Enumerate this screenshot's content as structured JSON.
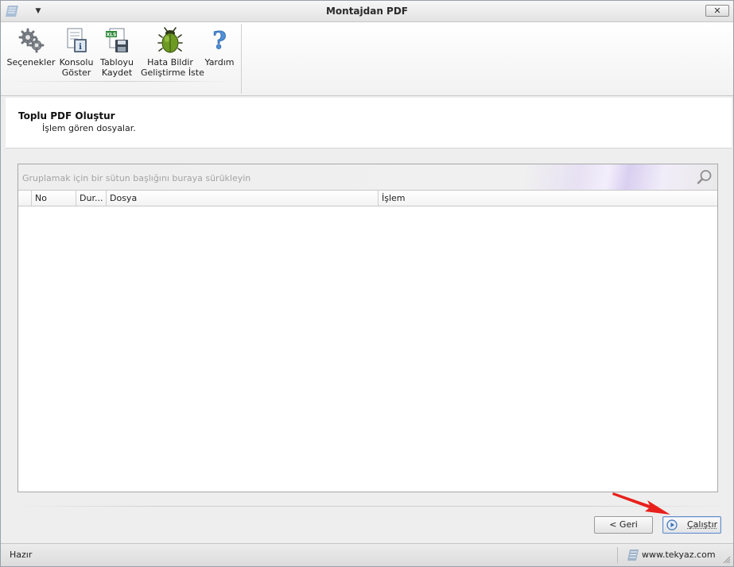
{
  "window": {
    "title": "Montajdan PDF",
    "close_label": "✕"
  },
  "ribbon": {
    "buttons": [
      {
        "label_line1": "Seçenekler",
        "label_line2": "",
        "icon": "gears-icon"
      },
      {
        "label_line1": "Konsolu",
        "label_line2": "Göster",
        "icon": "console-icon"
      },
      {
        "label_line1": "Tabloyu",
        "label_line2": "Kaydet",
        "icon": "xls-save-icon"
      },
      {
        "label_line1": "Hata Bildir",
        "label_line2": "Geliştirme İste",
        "icon": "bug-icon"
      },
      {
        "label_line1": "Yardım",
        "label_line2": "",
        "icon": "help-icon"
      }
    ]
  },
  "header": {
    "title": "Toplu PDF Oluştur",
    "subtitle": "İşlem gören dosyalar."
  },
  "grid": {
    "group_hint": "Gruplamak için bir sütun başlığını buraya sürükleyin",
    "columns": [
      "",
      "No",
      "Dur...",
      "Dosya",
      "İşlem"
    ],
    "rows": []
  },
  "buttons": {
    "back": "< Geri",
    "run": "Çalıştır"
  },
  "status": {
    "text": "Hazır",
    "site": "www.tekyaz.com"
  },
  "colors": {
    "accent": "#3d6fb6",
    "arrow": "#e8201c"
  }
}
